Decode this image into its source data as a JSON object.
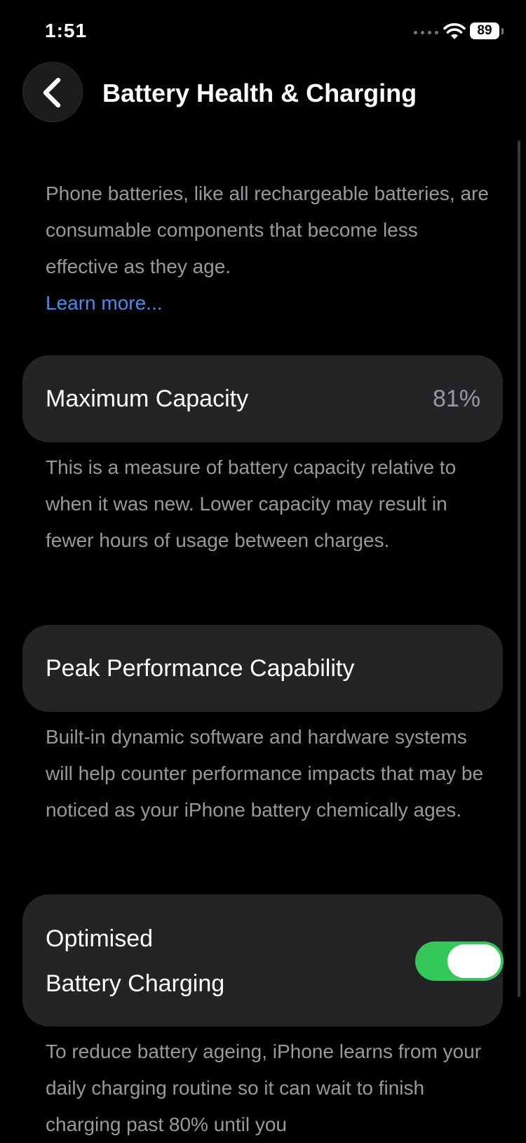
{
  "status_bar": {
    "time": "1:51",
    "battery_level": "89",
    "icons": [
      "cellular-signal-icon",
      "wifi-icon",
      "battery-icon"
    ]
  },
  "header": {
    "title": "Battery Health & Charging",
    "back_icon": "chevron-left-icon"
  },
  "intro": {
    "text": "Phone batteries, like all rechargeable batteries, are consumable components that become less effective as they age.",
    "link": "Learn more..."
  },
  "max_capacity": {
    "label": "Maximum Capacity",
    "value": "81%",
    "description": "This is a measure of battery capacity relative to when it was new. Lower capacity may result in fewer hours of usage between charges."
  },
  "peak_performance": {
    "label": "Peak Performance Capability",
    "description": "Built-in dynamic software and hardware systems will help counter performance impacts that may be noticed as your iPhone battery chemically ages."
  },
  "optimised_charging": {
    "label_line1": "Optimised",
    "label_line2": "Battery Charging",
    "enabled": true,
    "description": "To reduce battery ageing, iPhone learns from your daily charging routine so it can wait to finish charging past 80% until you"
  },
  "colors": {
    "background": "#000000",
    "card": "#242426",
    "secondary_text": "#98989e",
    "link": "#3d8ff4",
    "toggle_on": "#34c759"
  }
}
